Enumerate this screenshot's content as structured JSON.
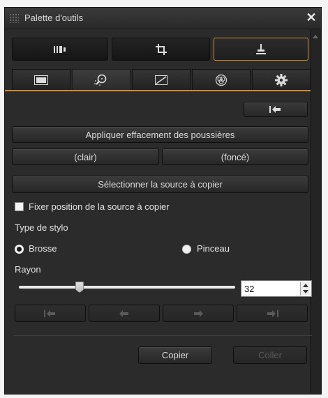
{
  "window": {
    "title": "Palette d'outils",
    "close_glyph": "✕"
  },
  "tools": [
    {
      "icon": "adjust-panel-icon",
      "selected": false
    },
    {
      "icon": "crop-icon",
      "selected": false
    },
    {
      "icon": "stamp-icon",
      "selected": true
    }
  ],
  "tabs": [
    {
      "icon": "image-frame-icon"
    },
    {
      "icon": "dust-inspect-icon",
      "active": true
    },
    {
      "icon": "curve-icon"
    },
    {
      "icon": "color-circles-icon"
    },
    {
      "icon": "gear-icon"
    }
  ],
  "buttons": {
    "apply_dust": "Appliquer effacement des poussières",
    "light": "(clair)",
    "dark": "(foncé)",
    "select_source": "Sélectionner la source à copier",
    "copy": "Copier",
    "paste": "Coller"
  },
  "checkbox": {
    "label": "Fixer position de la source à copier",
    "checked": false
  },
  "pen_type": {
    "label": "Type de stylo",
    "options": [
      {
        "label": "Brosse",
        "selected": true
      },
      {
        "label": "Pinceau",
        "selected": false
      }
    ]
  },
  "radius": {
    "label": "Rayon",
    "value": "32",
    "slider_fraction": 0.3
  },
  "colors": {
    "accent": "#d18a2c",
    "panel": "#2b2b2b"
  }
}
